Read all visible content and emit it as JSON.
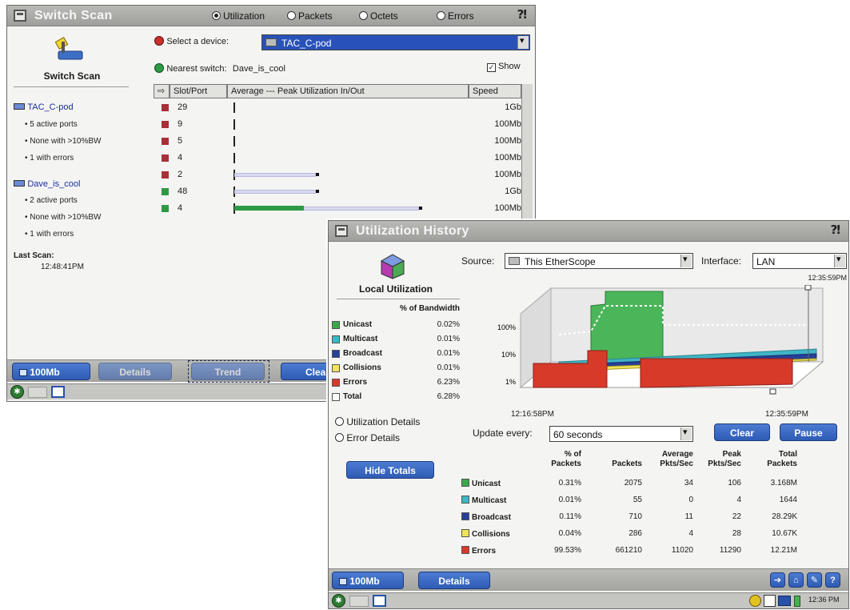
{
  "switch_scan": {
    "title": "Switch Scan",
    "view_options": [
      {
        "label": "Utilization",
        "selected": true
      },
      {
        "label": "Packets",
        "selected": false
      },
      {
        "label": "Octets",
        "selected": false
      },
      {
        "label": "Errors",
        "selected": false
      }
    ],
    "left_title": "Switch Scan",
    "devices": [
      {
        "name": "TAC_C-pod",
        "details": [
          "5 active ports",
          "None with >10%BW",
          "1 with errors"
        ]
      },
      {
        "name": "Dave_is_cool",
        "details": [
          "2 active ports",
          "None with >10%BW",
          "1 with errors"
        ]
      }
    ],
    "last_scan_label": "Last Scan:",
    "last_scan_time": "12:48:41PM",
    "select_device_label": "Select a device:",
    "select_device_value": "TAC_C-pod",
    "nearest_switch_label": "Nearest switch:",
    "nearest_switch_value": "Dave_is_cool",
    "show_label": "Show",
    "columns": {
      "slot": "Slot/Port",
      "util": "Average --- Peak Utilization In/Out",
      "speed": "Speed"
    },
    "ports": [
      {
        "slot": "29",
        "status": "red",
        "speed": "1Gb",
        "avg": 0.0,
        "peak": 0.0
      },
      {
        "slot": "9",
        "status": "red",
        "speed": "100Mb",
        "avg": 0.0,
        "peak": 0.0
      },
      {
        "slot": "5",
        "status": "red",
        "speed": "100Mb",
        "avg": 0.0,
        "peak": 0.0
      },
      {
        "slot": "4",
        "status": "red",
        "speed": "100Mb",
        "avg": 0.0,
        "peak": 0.0
      },
      {
        "slot": "2",
        "status": "red",
        "speed": "100Mb",
        "avg": 0.0,
        "peak": 0.34
      },
      {
        "slot": "48",
        "status": "green",
        "speed": "1Gb",
        "avg": 0.0,
        "peak": 0.34
      },
      {
        "slot": "4",
        "status": "green",
        "speed": "100Mb",
        "avg": 0.29,
        "peak": 0.77
      }
    ],
    "bottom_buttons": {
      "speed": "100Mb",
      "details": "Details",
      "trend": "Trend",
      "clear": "Clear"
    }
  },
  "util_history": {
    "title": "Utilization History",
    "left_title": "Local Utilization",
    "pct_bandwidth_label": "% of Bandwidth",
    "legend": [
      {
        "name": "Unicast",
        "value": "0.02%",
        "color": "#3aa84a"
      },
      {
        "name": "Multicast",
        "value": "0.01%",
        "color": "#3fb5c6"
      },
      {
        "name": "Broadcast",
        "value": "0.01%",
        "color": "#27409a"
      },
      {
        "name": "Collisions",
        "value": "0.01%",
        "color": "#f1e35a"
      },
      {
        "name": "Errors",
        "value": "6.23%",
        "color": "#d83a2a"
      },
      {
        "name": "Total",
        "value": "6.28%",
        "color": "#ffffff"
      }
    ],
    "detail_options": [
      {
        "label": "Utilization Details",
        "selected": true
      },
      {
        "label": "Error Details",
        "selected": false
      }
    ],
    "hide_totals": "Hide Totals",
    "source_label": "Source:",
    "source_value": "This EtherScope",
    "interface_label": "Interface:",
    "interface_value": "LAN",
    "time_top": "12:35:59PM",
    "time_left": "12:16:58PM",
    "time_right": "12:35:59PM",
    "update_label": "Update every:",
    "update_value": "60 seconds",
    "clear_btn": "Clear",
    "pause_btn": "Pause",
    "table_headers": [
      "% of Packets",
      "Packets",
      "Average Pkts/Sec",
      "Peak Pkts/Sec",
      "Total Packets"
    ],
    "table_rows": [
      {
        "name": "Unicast",
        "color": "#3aa84a",
        "cells": [
          "0.31%",
          "2075",
          "34",
          "106",
          "3.168M"
        ]
      },
      {
        "name": "Multicast",
        "color": "#3fb5c6",
        "cells": [
          "0.01%",
          "55",
          "0",
          "4",
          "1644"
        ]
      },
      {
        "name": "Broadcast",
        "color": "#27409a",
        "cells": [
          "0.11%",
          "710",
          "11",
          "22",
          "28.29K"
        ]
      },
      {
        "name": "Collisions",
        "color": "#f1e35a",
        "cells": [
          "0.04%",
          "286",
          "4",
          "28",
          "10.67K"
        ]
      },
      {
        "name": "Errors",
        "color": "#d83a2a",
        "cells": [
          "99.53%",
          "661210",
          "11020",
          "11290",
          "12.21M"
        ]
      }
    ],
    "bottom_buttons": {
      "speed": "100Mb",
      "details": "Details"
    },
    "clock": "12:36 PM",
    "chart_data": {
      "type": "area",
      "y_ticks": [
        "100%",
        "10%",
        "1%"
      ],
      "x_labels": [
        "12:16:58PM",
        "12:35:59PM"
      ],
      "log_scale": true
    }
  }
}
